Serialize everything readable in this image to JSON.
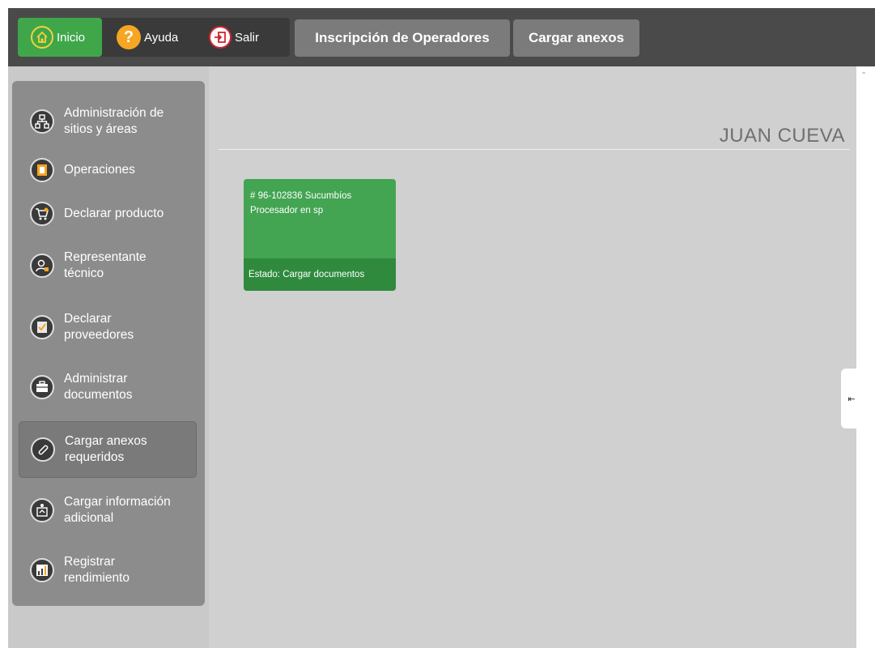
{
  "toolbar": {
    "home_label": "Inicio",
    "help_label": "Ayuda",
    "exit_label": "Salir",
    "tabs": [
      {
        "label": "Inscripción de Operadores"
      },
      {
        "label": "Cargar anexos"
      }
    ]
  },
  "sidebar": {
    "items": [
      {
        "line1": "Administración de",
        "line2": "sitios y áreas",
        "icon": "sitemap-icon"
      },
      {
        "line1": "Operaciones",
        "line2": "",
        "icon": "operations-icon"
      },
      {
        "line1": "Declarar producto",
        "line2": "",
        "icon": "cart-icon"
      },
      {
        "line1": "Representante",
        "line2": "técnico",
        "icon": "person-icon"
      },
      {
        "line1": "Declarar",
        "line2": "proveedores",
        "icon": "checklist-icon"
      },
      {
        "line1": "Administrar",
        "line2": "documentos",
        "icon": "briefcase-icon"
      },
      {
        "line1": "Cargar anexos",
        "line2": "requeridos",
        "icon": "paperclip-icon"
      },
      {
        "line1": "Cargar información",
        "line2": "adicional",
        "icon": "upload-info-icon"
      },
      {
        "line1": "Registrar",
        "line2": "rendimiento",
        "icon": "chart-icon"
      }
    ],
    "active_index": 6
  },
  "main": {
    "user_name": "JUAN CUEVA",
    "card": {
      "line1": "# 96-102836 Sucumbíos",
      "line2": "Procesador en sp",
      "status": "Estado: Cargar documentos"
    }
  },
  "colors": {
    "topbar": "#4a4a4a",
    "home_green": "#3fa74a",
    "card_green": "#43a452",
    "card_footer": "#2f8a3e",
    "sidebar": "#8c8c8c"
  }
}
